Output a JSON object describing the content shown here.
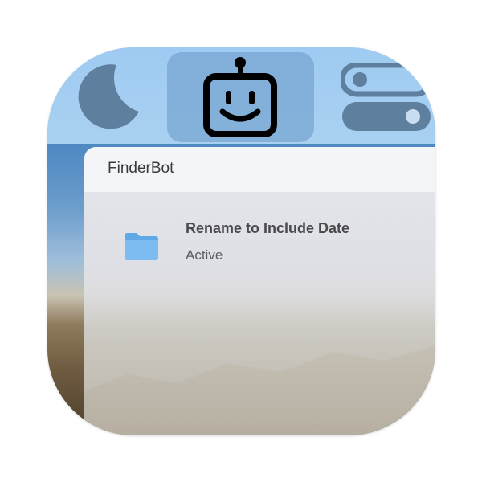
{
  "menubar": {
    "items": [
      {
        "icon": "moon-icon"
      },
      {
        "icon": "robot-icon",
        "active": true
      },
      {
        "icon": "toggle-switches-icon"
      }
    ]
  },
  "panel": {
    "title": "FinderBot",
    "rules": [
      {
        "icon": "folder-icon",
        "title": "Rename to Include Date",
        "status": "Active"
      }
    ]
  },
  "colors": {
    "menubar": "#a7ceef",
    "active_slot": "#8cb3d9",
    "moon": "#5f7f9f",
    "folder": "#6ab2ee"
  }
}
